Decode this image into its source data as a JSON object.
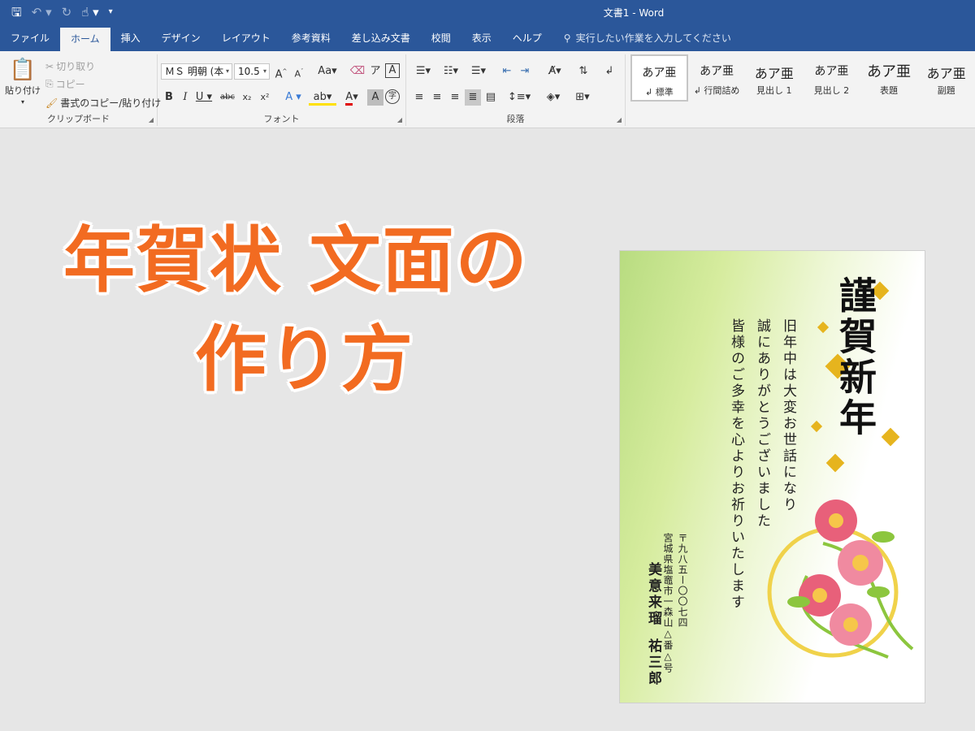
{
  "window": {
    "title": "文書1 - Word"
  },
  "qat": {
    "save_icon": "save-icon",
    "undo_icon": "undo-icon",
    "redo_icon": "redo-icon",
    "touch_icon": "touch-mode-icon"
  },
  "tabs": [
    "ファイル",
    "ホーム",
    "挿入",
    "デザイン",
    "レイアウト",
    "参考資料",
    "差し込み文書",
    "校閲",
    "表示",
    "ヘルプ"
  ],
  "active_tab": "ホーム",
  "tell_me": "実行したい作業を入力してください",
  "clipboard": {
    "paste_label": "貼り付け",
    "cut_label": "切り取り",
    "copy_label": "コピー",
    "format_painter_label": "書式のコピー/貼り付け",
    "group_label": "クリップボード"
  },
  "font": {
    "font_name": "ＭＳ 明朝 (本",
    "font_size": "10.5",
    "group_label": "フォント"
  },
  "paragraph": {
    "group_label": "段落"
  },
  "styles": [
    {
      "sample": "あア亜",
      "name": "↲ 標準"
    },
    {
      "sample": "あア亜",
      "name": "↲ 行間詰め"
    },
    {
      "sample": "あア亜",
      "name": "見出し 1"
    },
    {
      "sample": "あア亜",
      "name": "見出し 2"
    },
    {
      "sample": "あア亜",
      "name": "表題"
    },
    {
      "sample": "あア亜",
      "name": "副題"
    }
  ],
  "headline": {
    "line1": "年賀状 文面の",
    "line2": "作り方"
  },
  "card": {
    "greeting": "謹賀新年",
    "body": [
      "旧年中は大変お世話になり",
      "誠にありがとうございました",
      "皆様のご多幸を心よりお祈りいたします"
    ],
    "postal": "〒九八五ー〇〇七四",
    "address": "宮城県塩竈市一森山△番△号",
    "name1": "美意来瑠",
    "name2": "祐三郎"
  },
  "colors": {
    "accent": "#2b579a",
    "headline": "#f26b21",
    "gold": "#e6b41e"
  }
}
